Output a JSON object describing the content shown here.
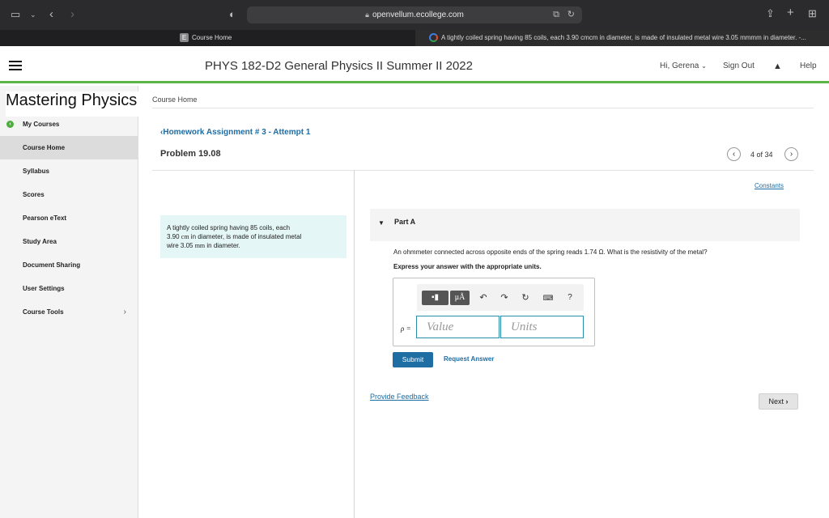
{
  "browser": {
    "url": "openvellum.ecollege.com",
    "tabs": [
      {
        "badge": "E",
        "label": "Course Home"
      },
      {
        "label": "A tightly coiled spring having 85 coils, each 3.90 cmcm in diameter, is made of insulated metal wire 3.05 mmmm in diameter. -..."
      }
    ]
  },
  "header": {
    "course_title": "PHYS 182-D2 General Physics II Summer II 2022",
    "user": "Hi, Gerena",
    "sign_out": "Sign Out",
    "help": "Help",
    "accent_color": "#5cb547"
  },
  "sidebar": {
    "title": "Mastering Physics",
    "items": [
      {
        "label": "My Courses"
      },
      {
        "label": "Course Home"
      },
      {
        "label": "Syllabus"
      },
      {
        "label": "Scores"
      },
      {
        "label": "Pearson eText"
      },
      {
        "label": "Study Area"
      },
      {
        "label": "Document Sharing"
      },
      {
        "label": "User Settings"
      },
      {
        "label": "Course Tools"
      }
    ]
  },
  "main": {
    "breadcrumb": "Course Home",
    "assignment_link": "Homework Assignment # 3 - Attempt 1",
    "problem_title": "Problem 19.08",
    "pager": "4 of 34",
    "problem_text_1": "A tightly coiled spring having 85 coils, each",
    "problem_text_2a": "3.90 ",
    "problem_unit_1": "cm",
    "problem_text_2b": " in diameter, is made of insulated metal",
    "problem_text_3a": "wire 3.05 ",
    "problem_unit_2": "mm",
    "problem_text_3b": " in diameter.",
    "constants": "Constants",
    "part_label": "Part A",
    "question": "An ohmmeter connected across opposite ends of the spring reads 1.74 Ω. What is the resistivity of the metal?",
    "instruction": "Express your answer with the appropriate units.",
    "answer_label": "ρ =",
    "value_placeholder": "Value",
    "units_placeholder": "Units",
    "toolbar": {
      "mu": "μÅ",
      "help": "?"
    },
    "submit": "Submit",
    "request_answer": "Request Answer",
    "feedback": "Provide Feedback",
    "next": "Next"
  }
}
